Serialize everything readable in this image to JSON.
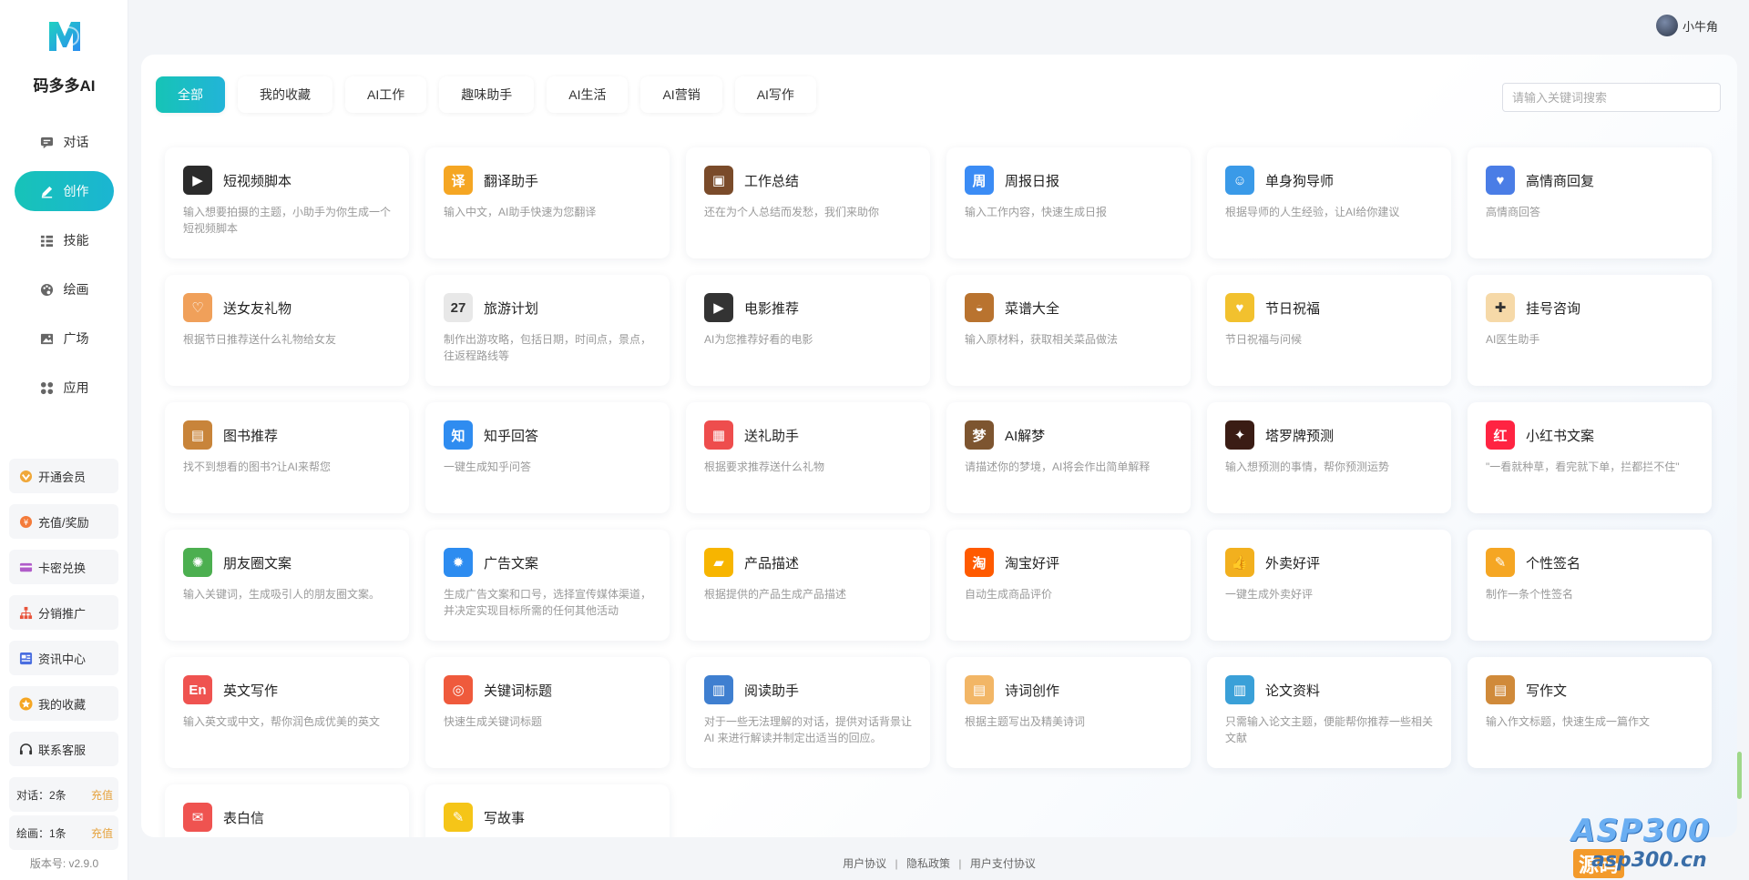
{
  "brand": {
    "name": "码多多AI"
  },
  "nav": [
    {
      "label": "对话",
      "icon": "chat-icon",
      "active": false
    },
    {
      "label": "创作",
      "icon": "pen-icon",
      "active": true
    },
    {
      "label": "技能",
      "icon": "list-icon",
      "active": false
    },
    {
      "label": "绘画",
      "icon": "palette-icon",
      "active": false
    },
    {
      "label": "广场",
      "icon": "image-icon",
      "active": false
    },
    {
      "label": "应用",
      "icon": "apps-icon",
      "active": false
    }
  ],
  "side_buttons": [
    {
      "label": "开通会员",
      "icon": "vip-icon"
    },
    {
      "label": "充值/奖励",
      "icon": "coin-icon"
    },
    {
      "label": "卡密兑换",
      "icon": "card-icon"
    },
    {
      "label": "分销推广",
      "icon": "share-icon"
    },
    {
      "label": "资讯中心",
      "icon": "news-icon"
    },
    {
      "label": "我的收藏",
      "icon": "star-icon"
    },
    {
      "label": "联系客服",
      "icon": "headset-icon"
    }
  ],
  "quota": [
    {
      "label": "对话：2条",
      "action": "充值"
    },
    {
      "label": "绘画：1条",
      "action": "充值"
    }
  ],
  "version": "版本号: v2.9.0",
  "user": {
    "name": "小牛角"
  },
  "tabs": [
    {
      "label": "全部",
      "active": true
    },
    {
      "label": "我的收藏",
      "active": false
    },
    {
      "label": "AI工作",
      "active": false
    },
    {
      "label": "趣味助手",
      "active": false
    },
    {
      "label": "AI生活",
      "active": false
    },
    {
      "label": "AI营销",
      "active": false
    },
    {
      "label": "AI写作",
      "active": false
    }
  ],
  "search": {
    "placeholder": "请输入关键词搜索",
    "value": ""
  },
  "cards": [
    {
      "title": "短视频脚本",
      "desc": "输入想要拍摄的主题，小助手为你生成一个短视频脚本",
      "icon": "clapperboard-icon",
      "color": "#2b2b2b",
      "glyph": "▶"
    },
    {
      "title": "翻译助手",
      "desc": "输入中文，AI助手快速为您翻译",
      "icon": "translate-icon",
      "color": "#f5a623",
      "glyph": "译"
    },
    {
      "title": "工作总结",
      "desc": "还在为个人总结而发愁，我们来助你",
      "icon": "briefcase-icon",
      "color": "#7a4b2a",
      "glyph": "▣"
    },
    {
      "title": "周报日报",
      "desc": "输入工作内容，快速生成日报",
      "icon": "report-icon",
      "color": "#3b8cf5",
      "glyph": "周"
    },
    {
      "title": "单身狗导师",
      "desc": "根据导师的人生经验，让AI给你建议",
      "icon": "id-card-icon",
      "color": "#3a9ae8",
      "glyph": "☺"
    },
    {
      "title": "高情商回复",
      "desc": "高情商回答",
      "icon": "heart-chat-icon",
      "color": "#4a7de6",
      "glyph": "♥"
    },
    {
      "title": "送女友礼物",
      "desc": "根据节日推荐送什么礼物给女友",
      "icon": "couple-icon",
      "color": "#f0a05a",
      "glyph": "♡"
    },
    {
      "title": "旅游计划",
      "desc": "制作出游攻略，包括日期，时间点，景点，往返程路线等",
      "icon": "calendar-icon",
      "color": "#e8e8e8",
      "glyph": "27"
    },
    {
      "title": "电影推荐",
      "desc": "AI为您推荐好看的电影",
      "icon": "movie-icon",
      "color": "#333333",
      "glyph": "▶"
    },
    {
      "title": "菜谱大全",
      "desc": "输入原材料，获取相关菜品做法",
      "icon": "bowl-icon",
      "color": "#b9732f",
      "glyph": "◒"
    },
    {
      "title": "节日祝福",
      "desc": "节日祝福与问候",
      "icon": "heart-badge-icon",
      "color": "#f2c12e",
      "glyph": "♥"
    },
    {
      "title": "挂号咨询",
      "desc": "AI医生助手",
      "icon": "doctor-icon",
      "color": "#f6d9a8",
      "glyph": "✚"
    },
    {
      "title": "图书推荐",
      "desc": "找不到想看的图书?让AI来帮您",
      "icon": "book-icon",
      "color": "#c8843a",
      "glyph": "▤"
    },
    {
      "title": "知乎回答",
      "desc": "一键生成知乎问答",
      "icon": "zhihu-icon",
      "color": "#2f8cf0",
      "glyph": "知"
    },
    {
      "title": "送礼助手",
      "desc": "根据要求推荐送什么礼物",
      "icon": "gift-icon",
      "color": "#ee4d4d",
      "glyph": "▦"
    },
    {
      "title": "AI解梦",
      "desc": "请描述你的梦境，AI将会作出简单解释",
      "icon": "dream-icon",
      "color": "#7d5530",
      "glyph": "梦"
    },
    {
      "title": "塔罗牌预测",
      "desc": "输入想预测的事情，帮你预测运势",
      "icon": "tarot-icon",
      "color": "#3a1c14",
      "glyph": "✦"
    },
    {
      "title": "小红书文案",
      "desc": "\"一看就种草，看完就下单，拦都拦不住\"",
      "icon": "xiaohongshu-icon",
      "color": "#ff2442",
      "glyph": "红"
    },
    {
      "title": "朋友圈文案",
      "desc": "输入关键词，生成吸引人的朋友圈文案。",
      "icon": "aperture-icon",
      "color": "#4caf50",
      "glyph": "✺"
    },
    {
      "title": "广告文案",
      "desc": "生成广告文案和口号，选择宣传媒体渠道，并决定实现目标所需的任何其他活动",
      "icon": "megaphone-icon",
      "color": "#2d8cf0",
      "glyph": "✹"
    },
    {
      "title": "产品描述",
      "desc": "根据提供的产品生成产品描述",
      "icon": "shopping-bag-icon",
      "color": "#f7b500",
      "glyph": "▰"
    },
    {
      "title": "淘宝好评",
      "desc": "自动生成商品评价",
      "icon": "taobao-icon",
      "color": "#ff5a00",
      "glyph": "淘"
    },
    {
      "title": "外卖好评",
      "desc": "一键生成外卖好评",
      "icon": "thumbs-up-icon",
      "color": "#f2b01e",
      "glyph": "👍"
    },
    {
      "title": "个性签名",
      "desc": "制作一条个性签名",
      "icon": "pencil-icon",
      "color": "#f5a623",
      "glyph": "✎"
    },
    {
      "title": "英文写作",
      "desc": "输入英文或中文，帮你润色成优美的英文",
      "icon": "english-icon",
      "color": "#ef5350",
      "glyph": "En"
    },
    {
      "title": "关键词标题",
      "desc": "快速生成关键词标题",
      "icon": "target-icon",
      "color": "#ef5a3c",
      "glyph": "◎"
    },
    {
      "title": "阅读助手",
      "desc": "对于一些无法理解的对话，提供对话背景让 AI 来进行解读并制定出适当的回应。",
      "icon": "books-icon",
      "color": "#3f7fd0",
      "glyph": "▥"
    },
    {
      "title": "诗词创作",
      "desc": "根据主题写出及精美诗词",
      "icon": "open-book-icon",
      "color": "#f2b666",
      "glyph": "▤"
    },
    {
      "title": "论文资料",
      "desc": "只需输入论文主题，便能帮你推荐一些相关文献",
      "icon": "binders-icon",
      "color": "#3aa0d8",
      "glyph": "▥"
    },
    {
      "title": "写作文",
      "desc": "输入作文标题，快速生成一篇作文",
      "icon": "notebook-icon",
      "color": "#d08a3a",
      "glyph": "▤"
    },
    {
      "title": "表白信",
      "desc": "",
      "icon": "envelope-icon",
      "color": "#ef5350",
      "glyph": "✉"
    },
    {
      "title": "写故事",
      "desc": "",
      "icon": "notepad-icon",
      "color": "#f5c518",
      "glyph": "✎"
    }
  ],
  "footer": {
    "links": [
      "用户协议",
      "隐私政策",
      "用户支付协议"
    ],
    "separator": "|"
  },
  "watermark": {
    "main": "ASP300",
    "tag": "源码",
    "sub": "asp300.cn"
  },
  "colors": {
    "accent": "#17c3b8",
    "accent2": "#22b4d8",
    "charge": "#e6a23c"
  }
}
